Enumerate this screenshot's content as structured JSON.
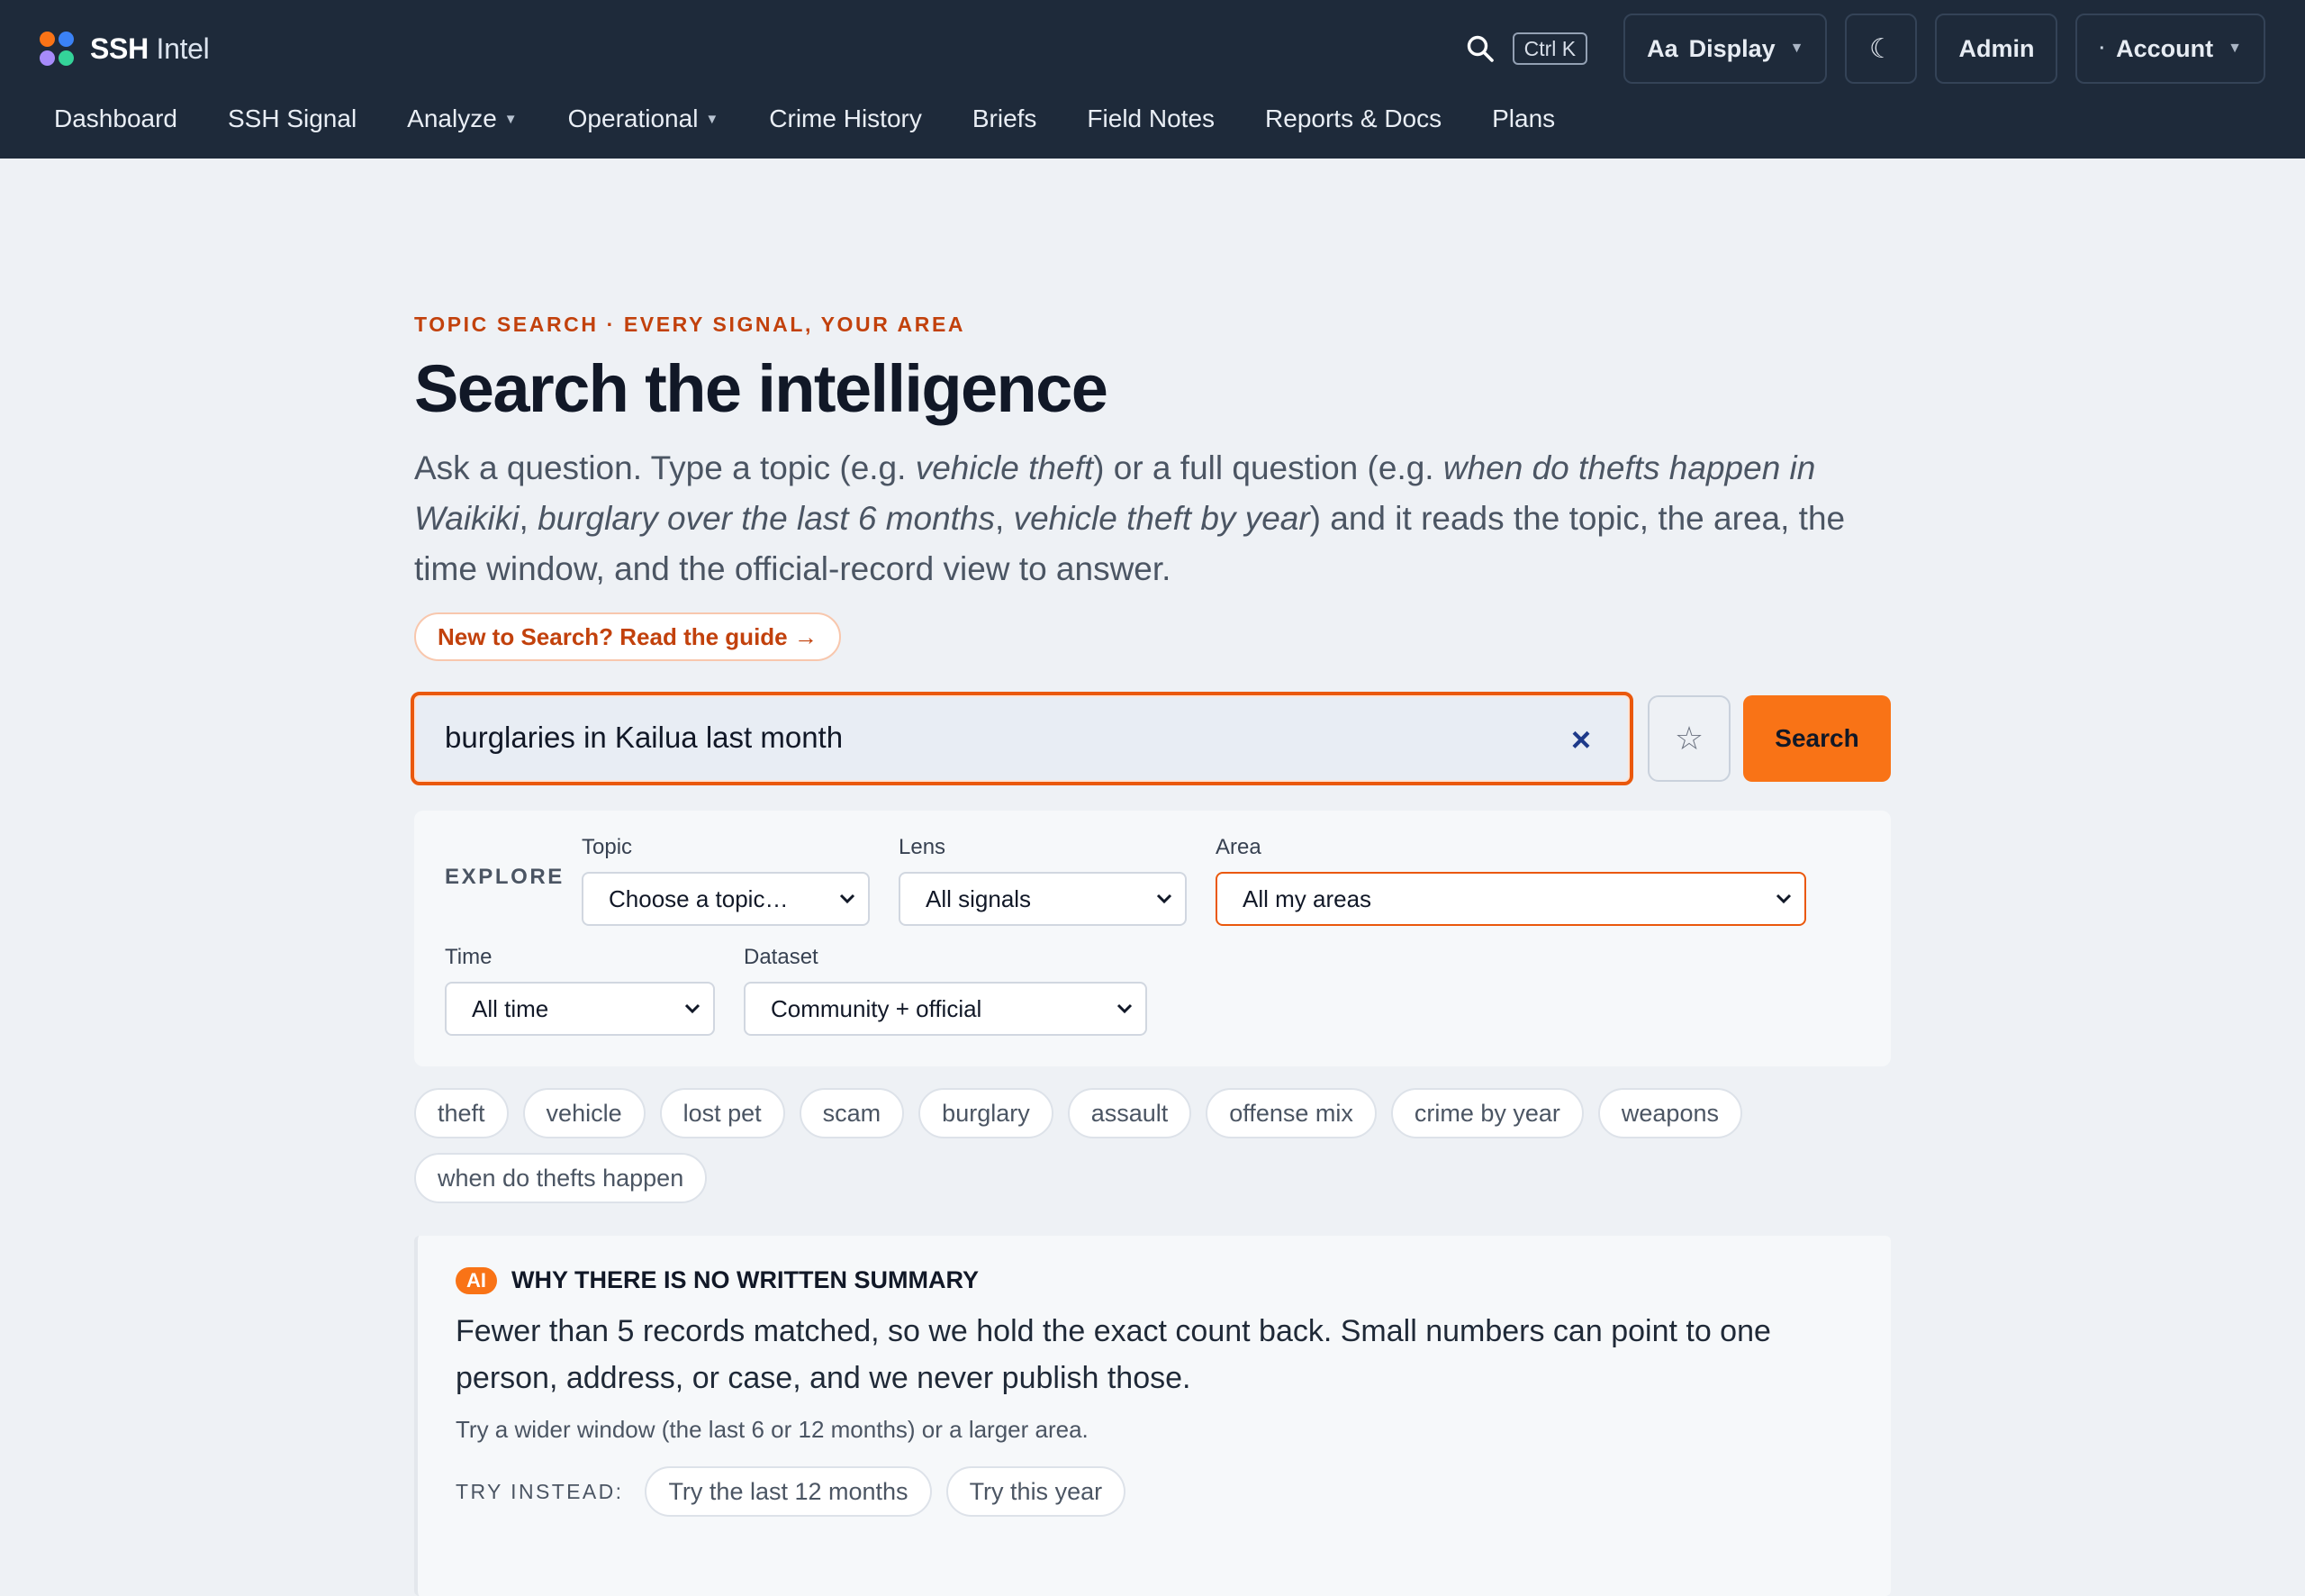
{
  "brand": {
    "name_bold": "SSH",
    "name_rest": " Intel",
    "dot_colors": [
      "#f97316",
      "#3b82f6",
      "#8b5cf6",
      "#22c55e"
    ]
  },
  "header": {
    "shortcut": "Ctrl K",
    "display_prefix": "Aa",
    "display_label": "Display",
    "theme_icon": "☾",
    "admin_label": "Admin",
    "account_label": "Account",
    "account_prefix": "·"
  },
  "nav": {
    "dashboard": "Dashboard",
    "signal": "SSH Signal",
    "analyze": "Analyze",
    "operational": "Operational",
    "crime_history": "Crime History",
    "briefs": "Briefs",
    "field_notes": "Field Notes",
    "reports": "Reports & Docs",
    "plans": "Plans"
  },
  "hero": {
    "eyebrow": "TOPIC SEARCH · EVERY SIGNAL, YOUR AREA",
    "title": "Search the intelligence",
    "lead_1": "Ask a question. Type a topic (e.g. ",
    "lead_2": "vehicle theft",
    "lead_3": ") or a full question (e.g. ",
    "lead_4": "when do thefts happen in Waikiki",
    "lead_5": ", ",
    "lead_6": "burglary over the last 6 months",
    "lead_7": ", ",
    "lead_8": "vehicle theft by year",
    "lead_9": ") and it reads the topic, the area, the time window, and the official-record view to answer.",
    "guide_link": "New to Search? Read the guide →"
  },
  "search": {
    "value": "burglaries in Kailua last month",
    "clear_icon": "×",
    "star_icon": "☆",
    "button": "Search"
  },
  "explore": {
    "label": "EXPLORE",
    "topic": {
      "label": "Topic",
      "value": "Choose a topic…"
    },
    "lens": {
      "label": "Lens",
      "value": "All signals"
    },
    "area": {
      "label": "Area",
      "value": "All my areas"
    },
    "time": {
      "label": "Time",
      "value": "All time"
    },
    "dataset": {
      "label": "Dataset",
      "value": "Community + official"
    }
  },
  "chips": [
    "theft",
    "vehicle",
    "lost pet",
    "scam",
    "burglary",
    "assault",
    "offense mix",
    "crime by year",
    "weapons",
    "when do thefts happen"
  ],
  "notice": {
    "badge": "AI",
    "title": "WHY THERE IS NO WRITTEN SUMMARY",
    "body": "Fewer than 5 records matched, so we hold the exact count back. Small numbers can point to one person, address, or case, and we never publish those.",
    "hint": "Try a wider window (the last 6 or 12 months) or a larger area.",
    "try_label": "TRY INSTEAD:",
    "try_1": "Try the last 12 months",
    "try_2": "Try this year"
  },
  "colors": {
    "header_bg": "#1e2a3a",
    "accent": "#f97316",
    "accent_text": "#c2410c"
  }
}
